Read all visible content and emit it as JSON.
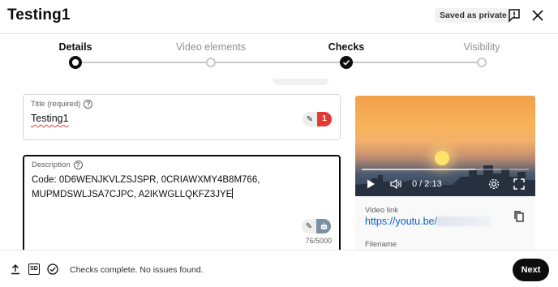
{
  "header": {
    "title": "Testing1",
    "saved_badge": "Saved as private"
  },
  "stepper": {
    "steps": [
      {
        "label": "Details",
        "state": "current"
      },
      {
        "label": "Video elements",
        "state": "pending"
      },
      {
        "label": "Checks",
        "state": "done"
      },
      {
        "label": "Visibility",
        "state": "pending"
      }
    ]
  },
  "form": {
    "title_field": {
      "label": "Title (required)",
      "value": "Testing1",
      "issue_count": "1"
    },
    "description_field": {
      "label": "Description",
      "value": "Code: 0D6WENJKVLZSJSPR, 0CRIAWXMY4B8M766, MUPMDSWLJSA7CJPC, A2IKWGLLQKFZ3JYE",
      "counter": "76/5000"
    }
  },
  "preview": {
    "time": "0 / 2:13",
    "video_link_label": "Video link",
    "video_link": "https://youtu.be/",
    "filename_label": "Filename"
  },
  "footer": {
    "status": "Checks complete. No issues found.",
    "next_label": "Next"
  },
  "colors": {
    "accent_red": "#e53935",
    "link_blue": "#065fd4",
    "primary_button": "#0d0d0d"
  }
}
